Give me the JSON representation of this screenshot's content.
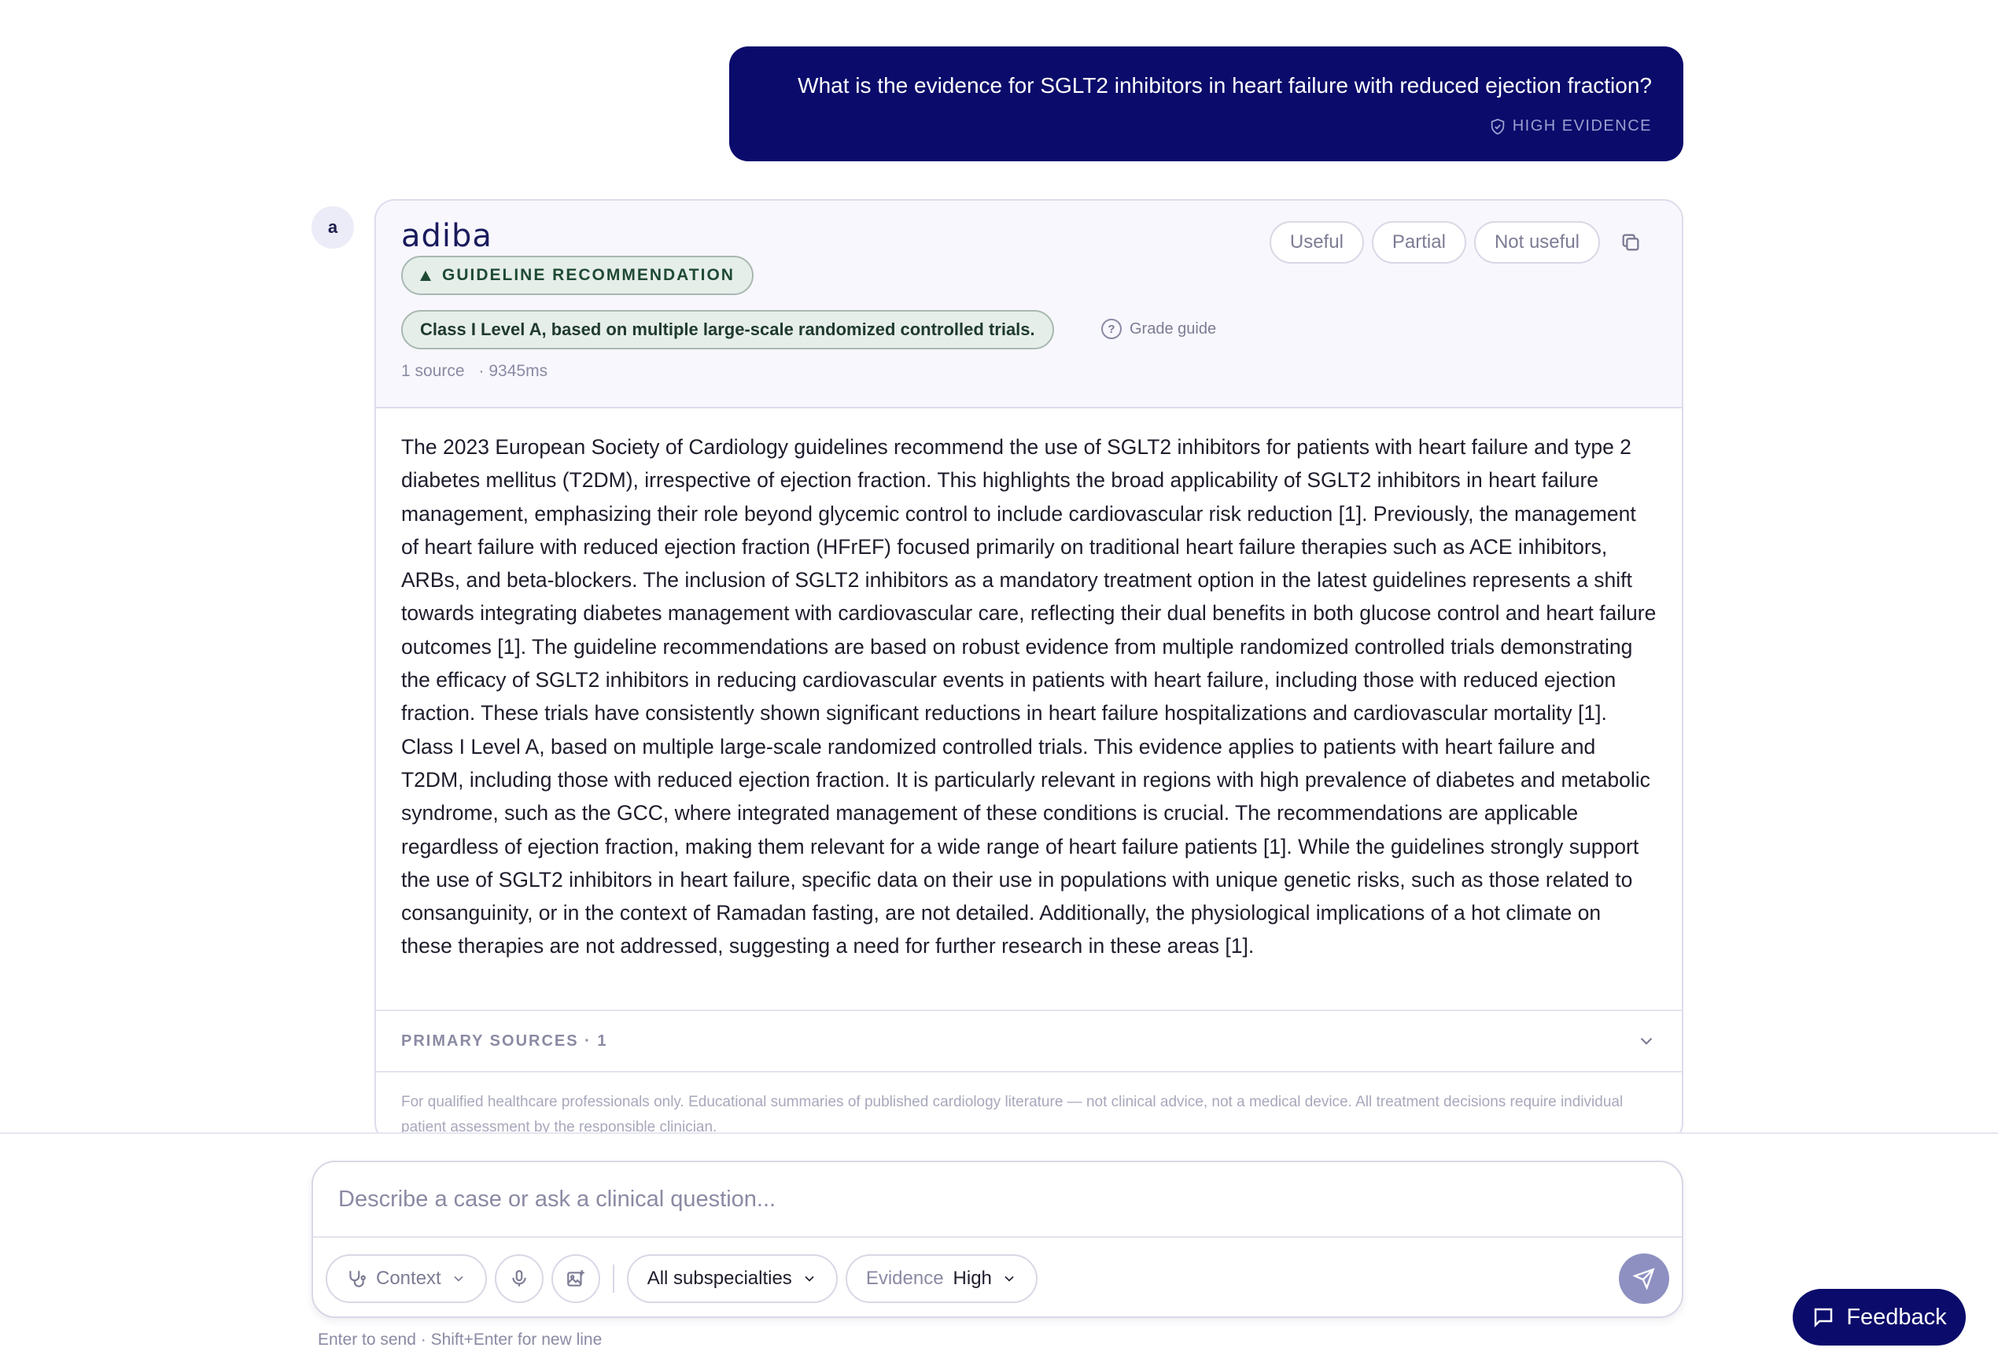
{
  "user_message": {
    "text": "What is the evidence for SGLT2 inhibitors in heart failure with reduced ejection fraction?",
    "badge": "HIGH EVIDENCE",
    "badge_icon": "shield-check-icon"
  },
  "assistant": {
    "avatar_letter": "a",
    "brand": "adiba",
    "recommendation_label": "GUIDELINE RECOMMENDATION",
    "class_label": "Class I Level A, based on multiple large-scale randomized controlled trials.",
    "grade_guide_label": "Grade guide",
    "source_count": "1 source",
    "latency": "· 9345ms",
    "feedback": {
      "useful": "Useful",
      "partial": "Partial",
      "not_useful": "Not useful"
    },
    "body": "The 2023 European Society of Cardiology guidelines recommend the use of SGLT2 inhibitors for patients with heart failure and type 2 diabetes mellitus (T2DM), irrespective of ejection fraction. This highlights the broad applicability of SGLT2 inhibitors in heart failure management, emphasizing their role beyond glycemic control to include cardiovascular risk reduction [1]. Previously, the management of heart failure with reduced ejection fraction (HFrEF) focused primarily on traditional heart failure therapies such as ACE inhibitors, ARBs, and beta-blockers. The inclusion of SGLT2 inhibitors as a mandatory treatment option in the latest guidelines represents a shift towards integrating diabetes management with cardiovascular care, reflecting their dual benefits in both glucose control and heart failure outcomes [1]. The guideline recommendations are based on robust evidence from multiple randomized controlled trials demonstrating the efficacy of SGLT2 inhibitors in reducing cardiovascular events in patients with heart failure, including those with reduced ejection fraction. These trials have consistently shown significant reductions in heart failure hospitalizations and cardiovascular mortality [1]. Class I Level A, based on multiple large-scale randomized controlled trials. This evidence applies to patients with heart failure and T2DM, including those with reduced ejection fraction. It is particularly relevant in regions with high prevalence of diabetes and metabolic syndrome, such as the GCC, where integrated management of these conditions is crucial. The recommendations are applicable regardless of ejection fraction, making them relevant for a wide range of heart failure patients [1]. While the guidelines strongly support the use of SGLT2 inhibitors in heart failure, specific data on their use in populations with unique genetic risks, such as those related to consanguinity, or in the context of Ramadan fasting, are not detailed. Additionally, the physiological implications of a hot climate on these therapies are not addressed, suggesting a need for further research in these areas [1].",
    "sources_label": "PRIMARY SOURCES · 1",
    "disclaimer": "For qualified healthcare professionals only. Educational summaries of published cardiology literature — not clinical advice, not a medical device. All treatment decisions require individual patient assessment by the responsible clinician."
  },
  "composer": {
    "placeholder": "Describe a case or ask a clinical question...",
    "value": "",
    "context_label": "Context",
    "subspecialty_label": "All subspecialties",
    "evidence_label": "Evidence",
    "evidence_value": "High",
    "hint": "Enter to send · Shift+Enter for new line"
  },
  "feedback_button": {
    "label": "Feedback"
  },
  "colors": {
    "navy": "#0b0b6b",
    "guideline_green": "#1f4a34",
    "send_disabled": "#8e90c2"
  }
}
